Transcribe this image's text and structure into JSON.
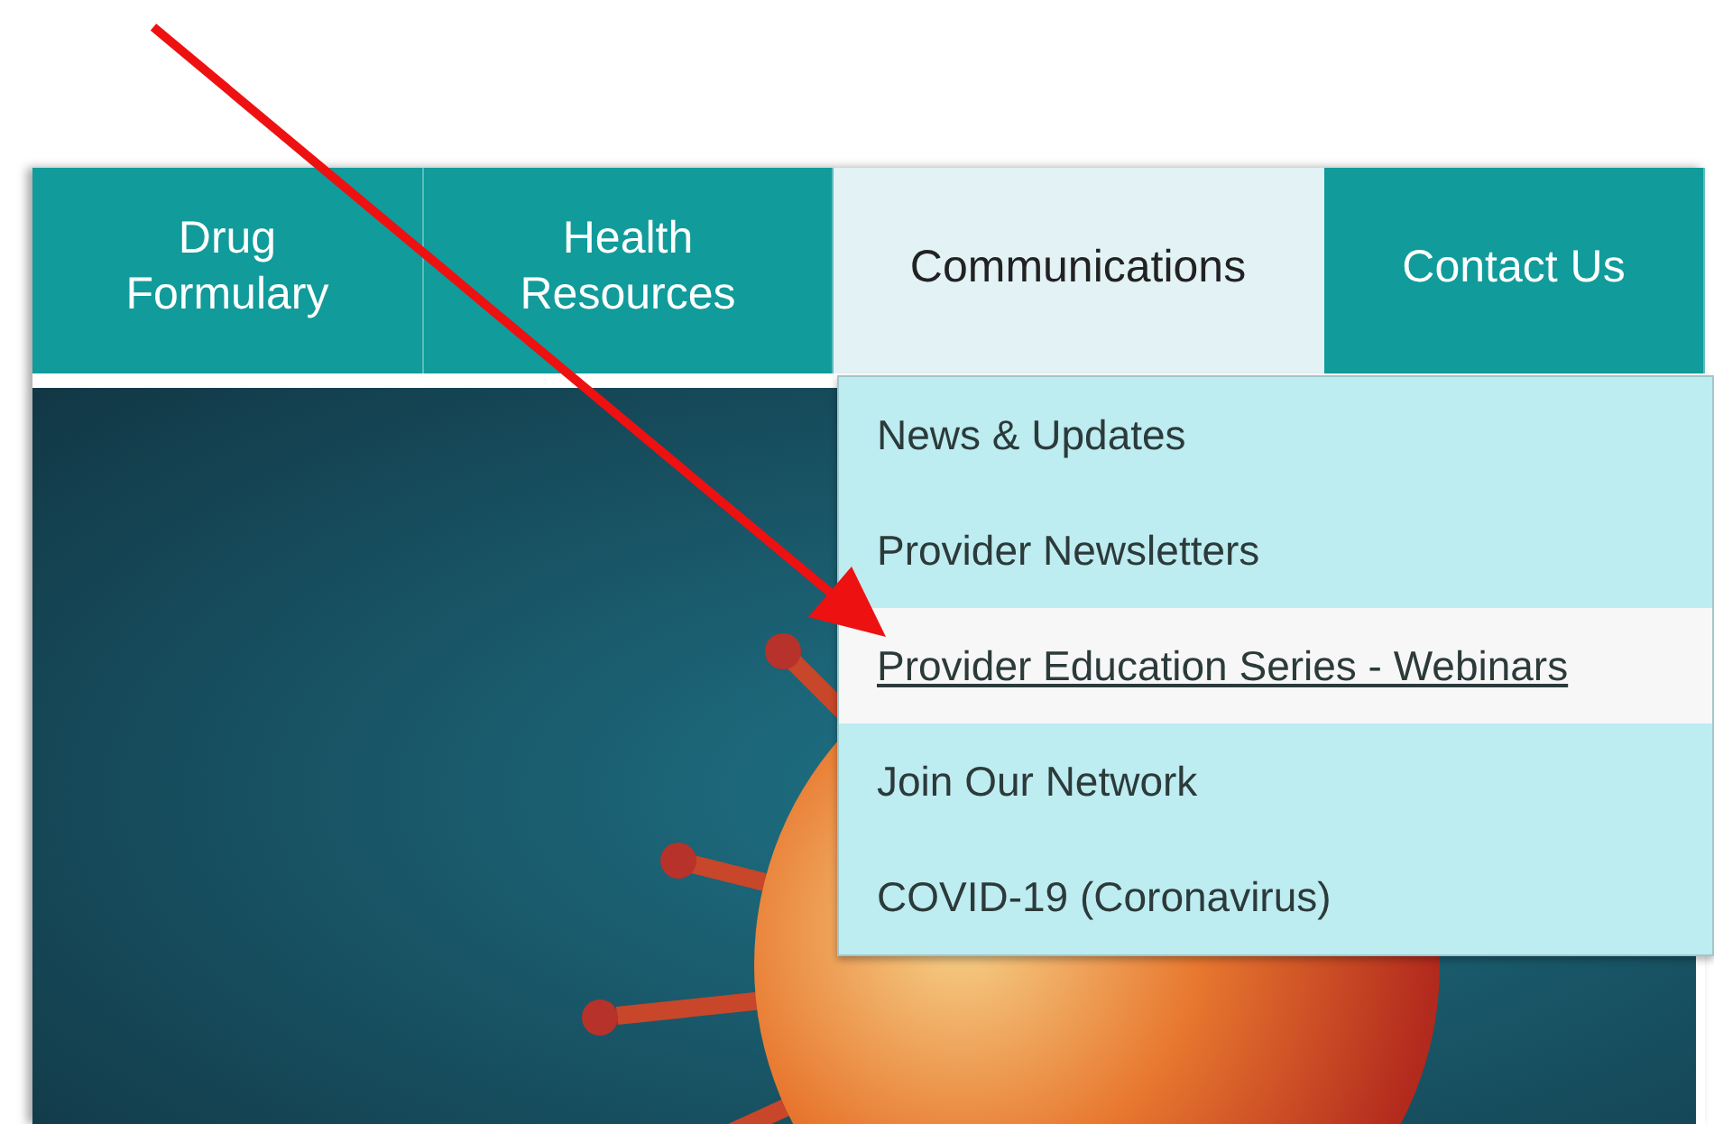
{
  "nav": {
    "tabs": [
      {
        "label": "Drug\nFormulary",
        "selected": false
      },
      {
        "label": "Health\nResources",
        "selected": false
      },
      {
        "label": "Communications",
        "selected": true
      },
      {
        "label": "Contact Us",
        "selected": false
      }
    ]
  },
  "dropdown": {
    "items": [
      {
        "label": "News & Updates",
        "highlighted": false
      },
      {
        "label": "Provider Newsletters",
        "highlighted": false
      },
      {
        "label": "Provider Education Series - Webinars",
        "highlighted": true
      },
      {
        "label": "Join Our Network",
        "highlighted": false
      },
      {
        "label": "COVID-19 (Coronavirus)",
        "highlighted": false
      }
    ]
  }
}
